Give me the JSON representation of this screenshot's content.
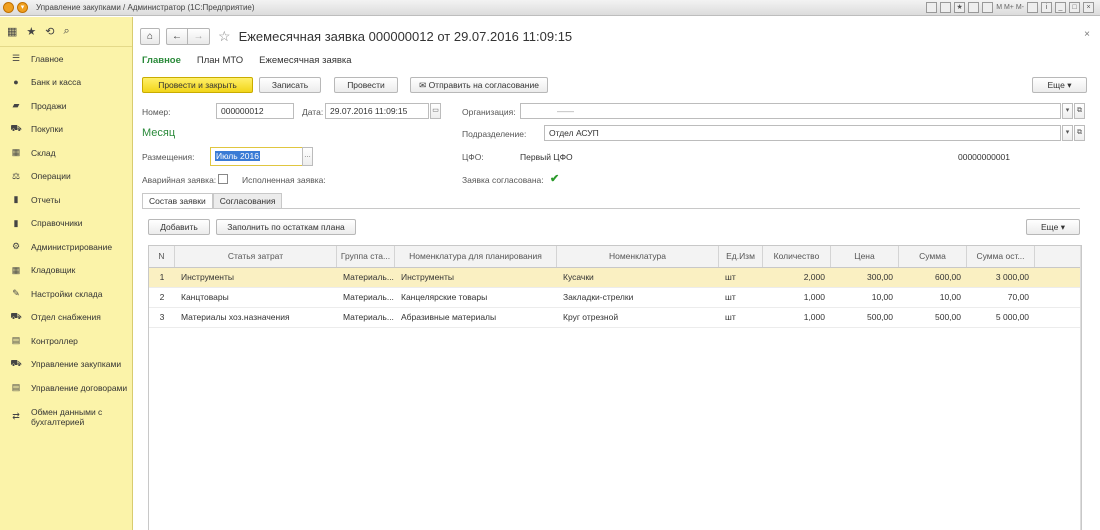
{
  "window": {
    "title": "Управление закупками / Администратор  (1С:Предприятие)",
    "tb_text": "M  M+  M-"
  },
  "sidebar": {
    "items": [
      {
        "label": "Главное",
        "icon": "menu-lines-icon"
      },
      {
        "label": "Банк и касса",
        "icon": "coin-icon"
      },
      {
        "label": "Продажи",
        "icon": "bag-icon"
      },
      {
        "label": "Покупки",
        "icon": "cart-icon"
      },
      {
        "label": "Склад",
        "icon": "warehouse-icon"
      },
      {
        "label": "Операции",
        "icon": "operations-icon"
      },
      {
        "label": "Отчеты",
        "icon": "bar-chart-icon"
      },
      {
        "label": "Справочники",
        "icon": "book-icon"
      },
      {
        "label": "Администрирование",
        "icon": "gear-icon"
      },
      {
        "label": "Кладовщик",
        "icon": "warehouse-icon"
      },
      {
        "label": "Настройки склада",
        "icon": "wrench-icon"
      },
      {
        "label": "Отдел снабжения",
        "icon": "cart-icon"
      },
      {
        "label": "Контроллер",
        "icon": "document-icon"
      },
      {
        "label": "Управление закупками",
        "icon": "cart-plus-icon"
      },
      {
        "label": "Управление договорами",
        "icon": "contract-icon"
      },
      {
        "label": "Обмен данными с бухгалтерией",
        "icon": "exchange-icon"
      }
    ]
  },
  "header": {
    "title": "Ежемесячная заявка 000000012 от 29.07.2016 11:09:15",
    "subnav": [
      "Главное",
      "План МТО",
      "Ежемесячная заявка"
    ]
  },
  "toolbar": {
    "post_close": "Провести и закрыть",
    "save": "Записать",
    "post": "Провести",
    "send": "Отправить на согласование",
    "more": "Еще"
  },
  "form": {
    "number_label": "Номер:",
    "number_value": "000000012",
    "date_label": "Дата:",
    "date_value": "29.07.2016 11:09:15",
    "org_label": "Организация:",
    "org_value": "——",
    "dept_label": "Подразделение:",
    "dept_value": "Отдел АСУП",
    "month_section": "Месяц",
    "placement_label": "Размещения:",
    "placement_value": "Июль 2016",
    "cfo_label": "ЦФО:",
    "cfo_value": "Первый ЦФО",
    "cfo_code": "00000000001",
    "emergency_label": "Аварийная заявка:",
    "executed_label": "Исполненная заявка:",
    "approved_label": "Заявка согласована:"
  },
  "tabs": [
    "Состав заявки",
    "Согласования"
  ],
  "table_toolbar": {
    "add": "Добавить",
    "fill": "Заполнить по остаткам плана",
    "more": "Еще"
  },
  "table": {
    "columns": [
      "N",
      "Статья затрат",
      "Группа ста...",
      "Номенклатура для планирования",
      "Номенклатура",
      "Ед.Изм",
      "Количество",
      "Цена",
      "Сумма",
      "Сумма ост..."
    ],
    "rows": [
      [
        "1",
        "Инструменты",
        "Материаль...",
        "Инструменты",
        "Кусачки",
        "шт",
        "2,000",
        "300,00",
        "600,00",
        "3 000,00"
      ],
      [
        "2",
        "Канцтовары",
        "Материаль...",
        "Канцелярские товары",
        "Закладки-стрелки",
        "шт",
        "1,000",
        "10,00",
        "10,00",
        "70,00"
      ],
      [
        "3",
        "Материалы хоз.назначения",
        "Материаль...",
        "Абразивные материалы",
        "Круг отрезной",
        "шт",
        "1,000",
        "500,00",
        "500,00",
        "5 000,00"
      ]
    ]
  }
}
